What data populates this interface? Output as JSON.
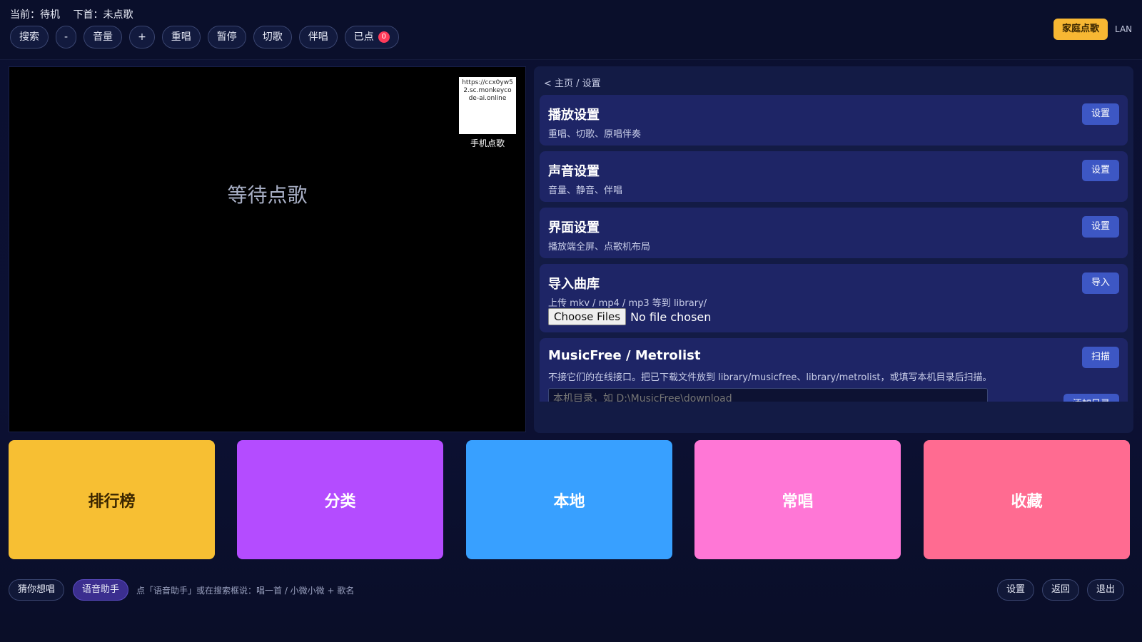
{
  "status": {
    "current": "当前：待机",
    "next": "下首：未点歌"
  },
  "controls": {
    "search": "搜索",
    "vol_down": "-",
    "volume": "音量",
    "vol_up": "+",
    "replay": "重唱",
    "pause": "暂停",
    "skip": "切歌",
    "accompany": "伴唱",
    "queued": "已点",
    "queued_count": "0"
  },
  "header_right": {
    "family_button": "家庭点歌",
    "lan": "LAN"
  },
  "player": {
    "waiting_text": "等待点歌",
    "qr_url": "https://ccx0yw52.sc.monkeycode-ai.online",
    "qr_label": "手机点歌"
  },
  "settings": {
    "breadcrumb": "< 主页 / 设置",
    "cards": [
      {
        "title": "播放设置",
        "desc": "重唱、切歌、原唱伴奏",
        "button": "设置"
      },
      {
        "title": "声音设置",
        "desc": "音量、静音、伴唱",
        "button": "设置"
      },
      {
        "title": "界面设置",
        "desc": "播放端全屏、点歌机布局",
        "button": "设置"
      },
      {
        "title": "导入曲库",
        "desc": "上传 mkv / mp4 / mp3 等到 library/",
        "button": "导入",
        "file_button": "Choose Files",
        "file_status": "No file chosen"
      },
      {
        "title": "MusicFree / Metrolist",
        "desc": "不接它们的在线接口。把已下载文件放到 library/musicfree、library/metrolist，或填写本机目录后扫描。",
        "button": "扫描",
        "input_placeholder": "本机目录，如 D:\\MusicFree\\download",
        "add_button": "添加目录"
      }
    ]
  },
  "tiles": [
    {
      "label": "排行榜",
      "color": "#f7bf33",
      "text_color": "#3a2600"
    },
    {
      "label": "分类",
      "color": "#b44cff",
      "text_color": "#ffffff"
    },
    {
      "label": "本地",
      "color": "#38a0ff",
      "text_color": "#ffffff"
    },
    {
      "label": "常唱",
      "color": "#ff77d6",
      "text_color": "#ffffff"
    },
    {
      "label": "收藏",
      "color": "#ff6b91",
      "text_color": "#ffffff"
    }
  ],
  "bottom": {
    "guess": "猜你想唱",
    "voice": "语音助手",
    "hint": "点「语音助手」或在搜索框说：唱一首 / 小微小微 + 歌名",
    "settings": "设置",
    "back": "返回",
    "exit": "退出"
  }
}
